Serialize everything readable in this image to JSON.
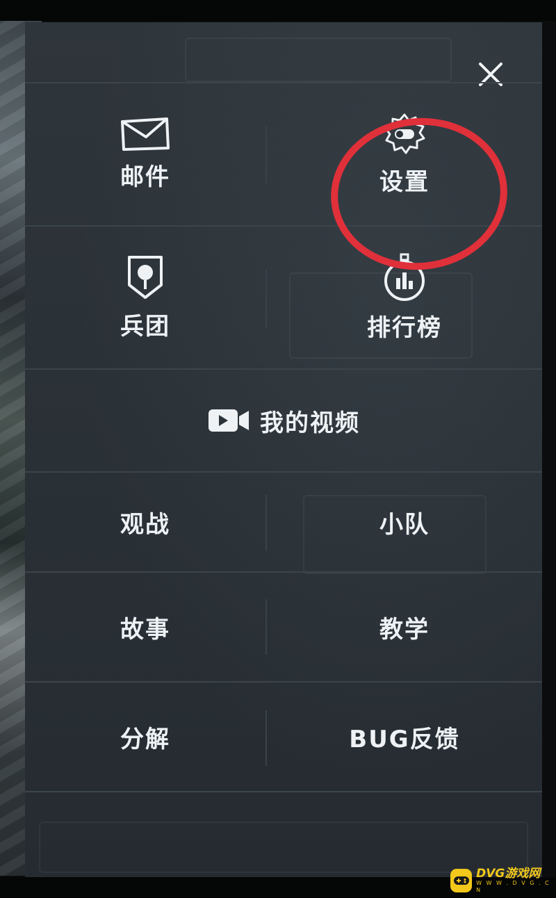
{
  "menu": {
    "mail_label": "邮件",
    "settings_label": "设置",
    "legion_label": "兵团",
    "leaderboard_label": "排行榜",
    "my_videos_label": "我的视频",
    "spectate_label": "观战",
    "squad_label": "小队",
    "story_label": "故事",
    "tutorial_label": "教学",
    "decompose_label": "分解",
    "bug_feedback_label": "BUG反馈"
  },
  "icons": {
    "close": "close-icon",
    "mail": "envelope-icon",
    "settings": "gear-toggle-icon",
    "legion": "shield-icon",
    "leaderboard": "bar-chart-medal-icon",
    "video": "video-camera-icon"
  },
  "annotation": {
    "highlight_color": "#e0303a"
  },
  "watermark": {
    "text": "DVG游戏网",
    "subtext": "W W W . D V G . C N"
  }
}
